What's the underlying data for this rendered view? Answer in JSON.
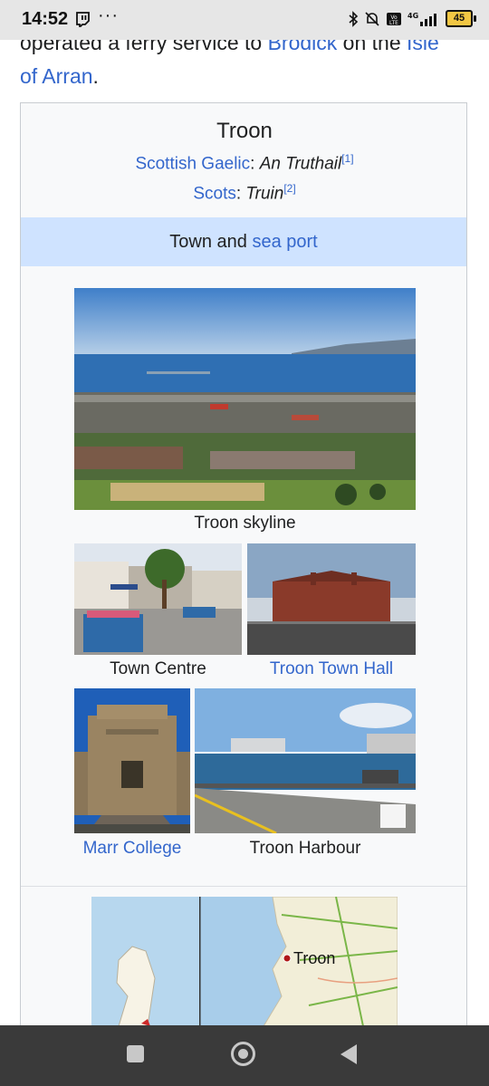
{
  "status_bar": {
    "time": "14:52",
    "more": "···",
    "battery": "45"
  },
  "article": {
    "intro_line1": "operated a ferry service to ",
    "intro_link1": "Brodick",
    "intro_mid": " on the ",
    "intro_link2": "Isle",
    "intro_line2_link": "of Arran",
    "intro_end": "."
  },
  "infobox": {
    "title": "Troon",
    "gaelic_label": "Scottish Gaelic",
    "gaelic_sep": ": ",
    "gaelic_name": "An Truthail",
    "gaelic_ref": "[1]",
    "scots_label": "Scots",
    "scots_sep": ": ",
    "scots_name": "Truin",
    "scots_ref": "[2]",
    "type_prefix": "Town and ",
    "type_link": "sea port",
    "captions": {
      "skyline": "Troon skyline",
      "town_centre": "Town Centre",
      "town_hall": "Troon Town Hall",
      "marr_college": "Marr College",
      "harbour": "Troon Harbour"
    },
    "map_label": "Troon"
  },
  "colors": {
    "link": "#3366cc",
    "type_row_bg": "#cfe3ff",
    "infobox_bg": "#f8f9fa"
  }
}
